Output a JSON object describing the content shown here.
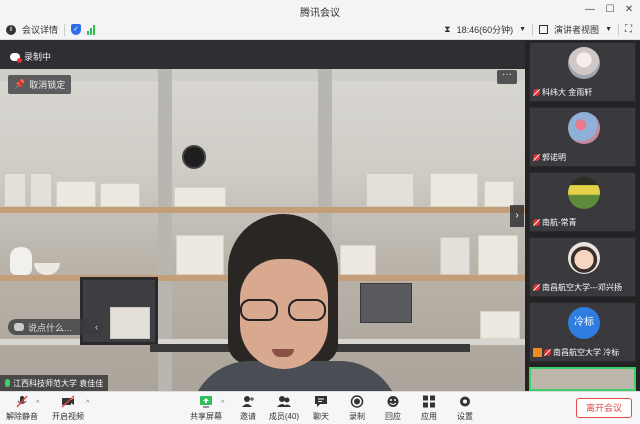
{
  "window": {
    "title": "腾讯会议"
  },
  "infobar": {
    "meeting_details": "会议详情",
    "timer": "18:46(60分钟)",
    "view_mode": "演讲者视图"
  },
  "main": {
    "recording_label": "录制中",
    "unpin_label": "取消锁定",
    "more_label": "···",
    "chat_placeholder": "说点什么...",
    "speaker_name": "江西科技师范大学 袁佳佳"
  },
  "participants": [
    {
      "name": "科纬大 金雨轩"
    },
    {
      "name": "郭诺明"
    },
    {
      "name": "南航-常青"
    },
    {
      "name": "南昌航空大学---邓兴扬"
    },
    {
      "name": "南昌航空大学 冷标",
      "avatar_text": "冷标"
    }
  ],
  "toolbar": {
    "unmute": "解除静音",
    "start_video": "开启视频",
    "share_screen": "共享屏幕",
    "invite": "邀请",
    "members": "成员(40)",
    "chat": "聊天",
    "record": "录制",
    "reactions": "回应",
    "apps": "应用",
    "settings": "设置",
    "leave": "离开会议"
  },
  "colors": {
    "accent": "#2f6ee8",
    "danger": "#e04a4a",
    "signal": "#2fbf57",
    "avatar_blue": "#2f7de0"
  }
}
